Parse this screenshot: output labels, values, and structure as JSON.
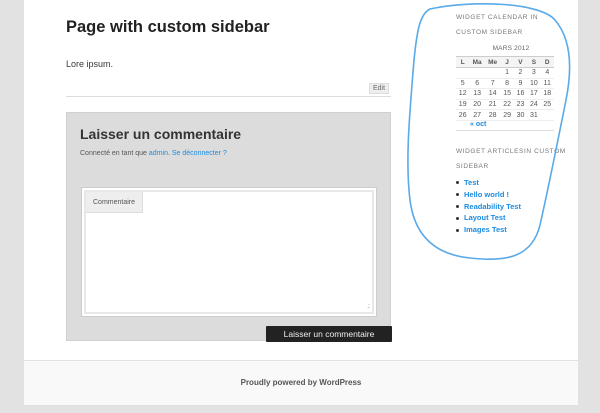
{
  "post": {
    "title": "Page with custom sidebar",
    "body": "Lore ipsum.",
    "edit_label": "Edit"
  },
  "comments": {
    "title": "Laisser un commentaire",
    "logged_in_prefix": "Connecté en tant que",
    "user": "admin",
    "logout_label": "Se déconnecter ?",
    "field_label": "Commentaire",
    "submit_label": "Laisser un commentaire"
  },
  "sidebar": {
    "calendar_widget_title": "Widget calendar in custom sidebar",
    "calendar": {
      "caption": "MARS 2012",
      "weekdays": [
        "L",
        "Ma",
        "Me",
        "J",
        "V",
        "S",
        "D"
      ],
      "weeks": [
        [
          "",
          "",
          "",
          "1",
          "2",
          "3",
          "4"
        ],
        [
          "5",
          "6",
          "7",
          "8",
          "9",
          "10",
          "11"
        ],
        [
          "12",
          "13",
          "14",
          "15",
          "16",
          "17",
          "18"
        ],
        [
          "19",
          "20",
          "21",
          "22",
          "23",
          "24",
          "25"
        ],
        [
          "26",
          "27",
          "28",
          "29",
          "30",
          "31",
          ""
        ]
      ],
      "prev_label": "« oct"
    },
    "articles_widget_title": "Widget articlesin custom sidebar",
    "articles": [
      "Test",
      "Hello world !",
      "Readability Test",
      "Layout Test",
      "Images Test"
    ]
  },
  "footer": {
    "credit": "Proudly powered by WordPress"
  },
  "colors": {
    "link": "#1b8be0",
    "annotation": "#5aaae8",
    "button": "#222222"
  }
}
